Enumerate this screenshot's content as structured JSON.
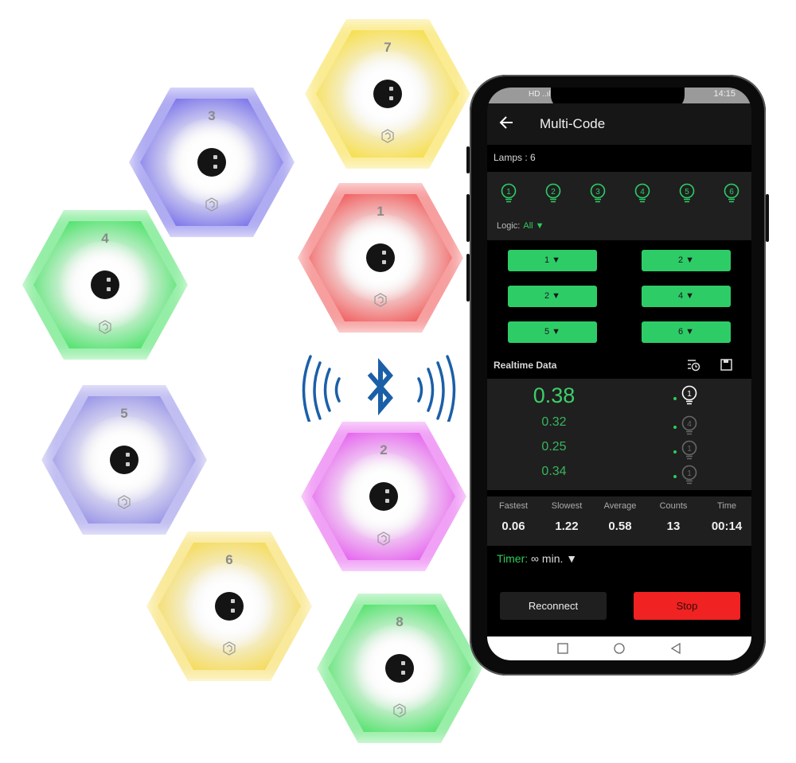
{
  "lamps_display": [
    {
      "number": "7",
      "color": "#f7dc3a"
    },
    {
      "number": "3",
      "color": "#6f68e8"
    },
    {
      "number": "4",
      "color": "#3fe05e"
    },
    {
      "number": "1",
      "color": "#f05050"
    },
    {
      "number": "5",
      "color": "#8f8ae6"
    },
    {
      "number": "2",
      "color": "#e455ee"
    },
    {
      "number": "6",
      "color": "#f5d84a"
    },
    {
      "number": "8",
      "color": "#45e060"
    }
  ],
  "bluetooth": {
    "icon": "bluetooth-icon",
    "color": "#1b5fa8"
  },
  "phone": {
    "status_bar": {
      "left": "HD ..ıl",
      "time": "14:15"
    },
    "app_bar": {
      "title": "Multi-Code",
      "back_icon": "arrow-left-icon"
    },
    "lamps_label": "Lamps : 6",
    "lamp_icons": [
      "1",
      "2",
      "3",
      "4",
      "5",
      "6"
    ],
    "logic": {
      "label": "Logic:",
      "value": "All ▼"
    },
    "lamp_selectors": [
      "1 ▼",
      "2 ▼",
      "2 ▼",
      "4 ▼",
      "5 ▼",
      "6 ▼"
    ],
    "realtime": {
      "title": "Realtime Data",
      "history_icon": "history-icon",
      "save_icon": "save-icon",
      "rows": [
        {
          "value": "0.38",
          "lamp": "1",
          "active": true
        },
        {
          "value": "0.32",
          "lamp": "4",
          "active": false
        },
        {
          "value": "0.25",
          "lamp": "1",
          "active": false
        },
        {
          "value": "0.34",
          "lamp": "1",
          "active": false
        }
      ]
    },
    "stats": [
      {
        "label": "Fastest",
        "value": "0.06"
      },
      {
        "label": "Slowest",
        "value": "1.22"
      },
      {
        "label": "Average",
        "value": "0.58"
      },
      {
        "label": "Counts",
        "value": "13"
      },
      {
        "label": "Time",
        "value": "00:14"
      }
    ],
    "timer": {
      "label": "Timer:",
      "value": "∞ min. ▼"
    },
    "buttons": {
      "reconnect": "Reconnect",
      "stop": "Stop"
    },
    "accent": "#2ecc67",
    "stop_color": "#f02222"
  }
}
